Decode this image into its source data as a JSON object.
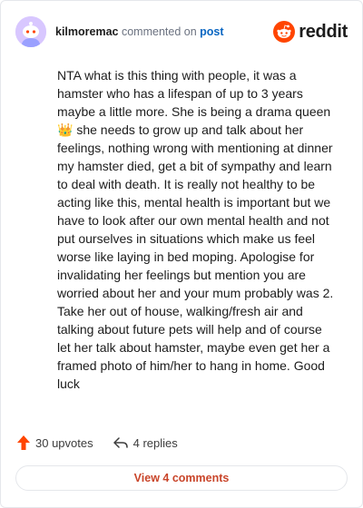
{
  "header": {
    "username": "kilmoremac",
    "action_text": "commented on",
    "target_text": "post",
    "brand_name": "reddit"
  },
  "comment": {
    "text": "NTA what is this thing with people, it was a hamster who has a lifespan of up to 3 years maybe a little more. She is being a drama queen 👑 she needs to grow up and talk about her feelings, nothing wrong with mentioning at dinner my hamster died, get a bit of sympathy and learn to deal with death. It is really not healthy to be acting like this, mental health is important but we have to look after our own mental health and not put ourselves in situations which make us feel worse like laying in bed moping. Apologise for invalidating her feelings but mention you are worried about her and your mum probably was 2. Take her out of house, walking/fresh air and talking about future pets will help and of course let her talk about hamster, maybe even get her a framed photo of him/her to hang in home. Good luck"
  },
  "actions": {
    "upvotes_label": "30 upvotes",
    "replies_label": "4 replies"
  },
  "footer": {
    "view_comments_label": "View 4 comments"
  },
  "colors": {
    "brand_orange": "#ff4500",
    "upvote_orange": "#ff4500",
    "link_blue": "#0a66c2",
    "view_button_text": "#c9452a",
    "avatar_bg": "#d8c7ff"
  },
  "icons": {
    "avatar": "snoo-avatar-icon",
    "brand": "reddit-logo-icon",
    "upvote": "upvote-arrow-icon",
    "reply": "reply-arrow-icon"
  }
}
